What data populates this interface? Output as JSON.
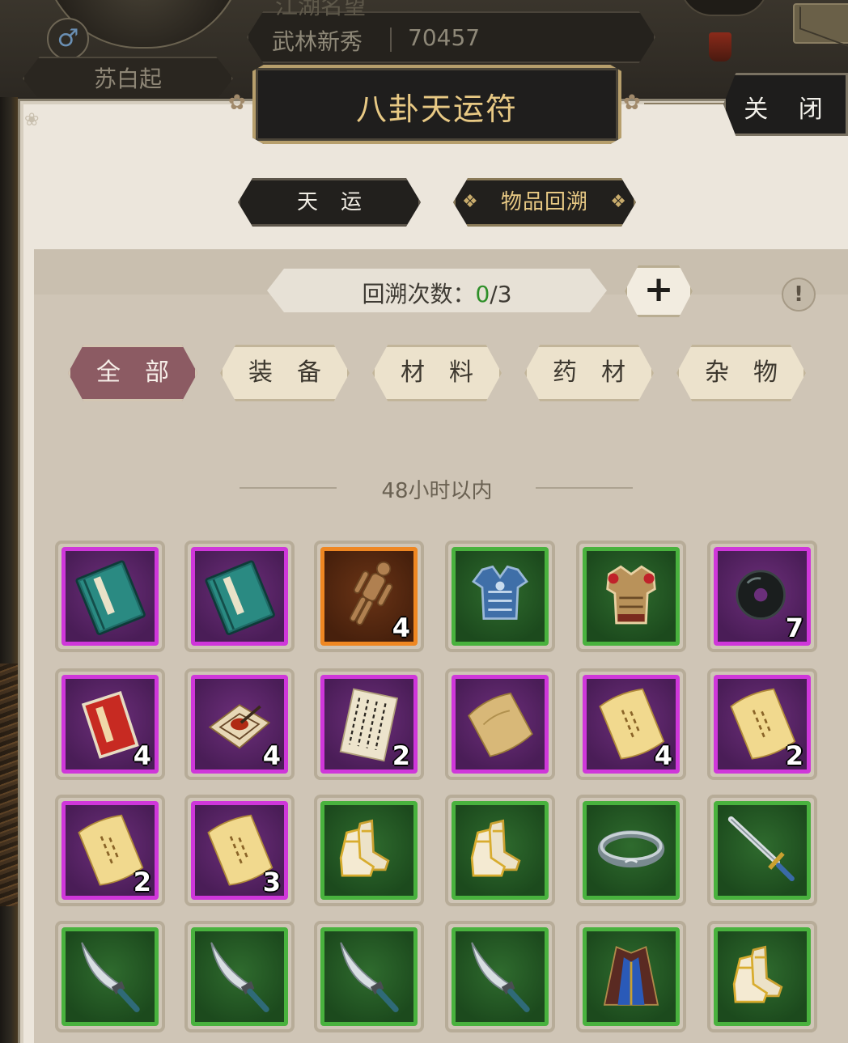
{
  "header": {
    "gender_symbol": "♂",
    "player_name": "苏白起",
    "fame_label": "江湖名望",
    "fame_title": "武林新秀",
    "fame_value": "70457"
  },
  "dialog": {
    "title": "八卦天运符",
    "close_label": "关 闭"
  },
  "tabs": [
    {
      "label": "天运",
      "active": false
    },
    {
      "label": "物品回溯",
      "active": true
    }
  ],
  "counter": {
    "label": "回溯次数：",
    "current": "0",
    "total": "/3",
    "add_label": "+",
    "info_label": "!"
  },
  "filters": [
    {
      "label": "全部",
      "active": true
    },
    {
      "label": "装备",
      "active": false
    },
    {
      "label": "材料",
      "active": false
    },
    {
      "label": "药材",
      "active": false
    },
    {
      "label": "杂物",
      "active": false
    }
  ],
  "section_label": "48小时以内",
  "colors": {
    "purple_quality": "#cf37da",
    "green_quality": "#49b23e",
    "orange_quality": "#ef8722",
    "active_filter": "#8c5b63",
    "title_gold": "#e8c984"
  },
  "items": [
    {
      "icon": "martial-book-icon",
      "quality": "purple",
      "qty": ""
    },
    {
      "icon": "martial-book-icon",
      "quality": "purple",
      "qty": ""
    },
    {
      "icon": "wooden-dummy-icon",
      "quality": "orange",
      "qty": "4"
    },
    {
      "icon": "blue-armor-icon",
      "quality": "green",
      "qty": ""
    },
    {
      "icon": "gold-armor-icon",
      "quality": "green",
      "qty": ""
    },
    {
      "icon": "black-jade-icon",
      "quality": "purple",
      "qty": "7"
    },
    {
      "icon": "red-booklet-icon",
      "quality": "purple",
      "qty": "4"
    },
    {
      "icon": "ink-board-icon",
      "quality": "purple",
      "qty": "4"
    },
    {
      "icon": "calligraphy-scroll-icon",
      "quality": "purple",
      "qty": "2"
    },
    {
      "icon": "old-paper-icon",
      "quality": "purple",
      "qty": ""
    },
    {
      "icon": "scroll-icon",
      "quality": "purple",
      "qty": "4"
    },
    {
      "icon": "scroll-icon",
      "quality": "purple",
      "qty": "2"
    },
    {
      "icon": "scroll-icon",
      "quality": "purple",
      "qty": "2"
    },
    {
      "icon": "scroll-icon",
      "quality": "purple",
      "qty": "3"
    },
    {
      "icon": "boots-icon",
      "quality": "green",
      "qty": ""
    },
    {
      "icon": "boots-icon",
      "quality": "green",
      "qty": ""
    },
    {
      "icon": "bracelet-icon",
      "quality": "green",
      "qty": ""
    },
    {
      "icon": "sword-icon",
      "quality": "green",
      "qty": ""
    },
    {
      "icon": "curved-blade-icon",
      "quality": "green",
      "qty": ""
    },
    {
      "icon": "curved-blade-icon",
      "quality": "green",
      "qty": ""
    },
    {
      "icon": "curved-blade-icon",
      "quality": "green",
      "qty": ""
    },
    {
      "icon": "curved-blade-icon",
      "quality": "green",
      "qty": ""
    },
    {
      "icon": "robe-icon",
      "quality": "green",
      "qty": ""
    },
    {
      "icon": "boots-icon",
      "quality": "green",
      "qty": ""
    }
  ]
}
